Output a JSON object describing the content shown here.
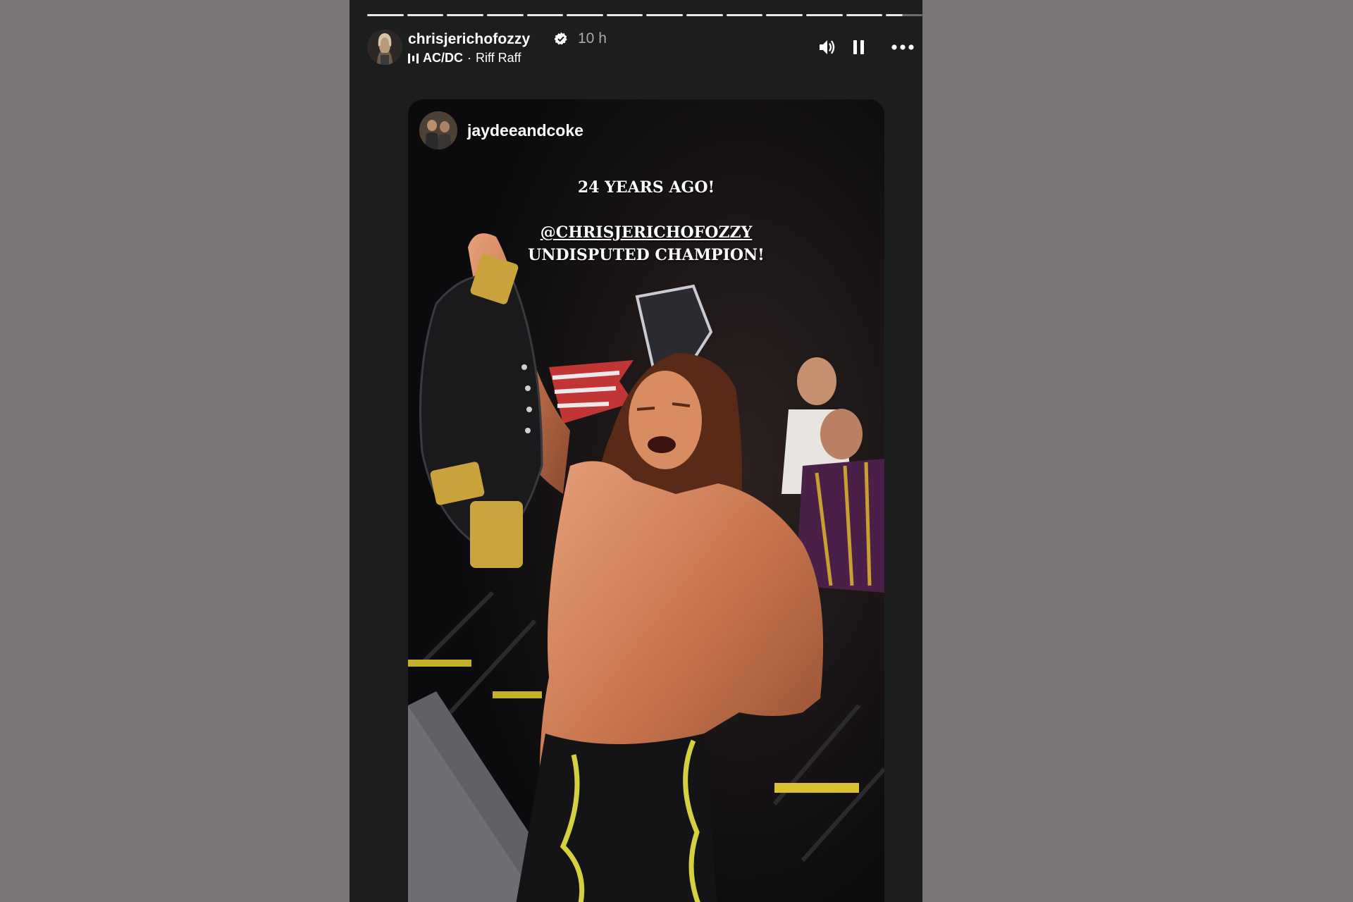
{
  "story": {
    "progress_segments": 14,
    "active_segment_fraction": 0.45,
    "header": {
      "username": "chrisjerichofozzy",
      "time_ago": "10 h",
      "music_artist": "AC/DC",
      "music_separator": "·",
      "music_track": "Riff Raff"
    },
    "controls": {
      "volume_icon": "speaker-icon",
      "pause_icon": "pause-icon",
      "more_icon": "more-dots-icon"
    },
    "shared_post": {
      "username": "jaydeeandcoke",
      "caption_line1": "24 YEARS AGO!",
      "caption_mention": "@CHRISJERICHOFOZZY",
      "caption_line3": "UNDISPUTED CHAMPION!"
    }
  },
  "colors": {
    "page_bg": "#7a7576",
    "story_bg": "#1c1e1e",
    "text_primary": "#ffffff",
    "text_secondary": "#a9abab"
  }
}
